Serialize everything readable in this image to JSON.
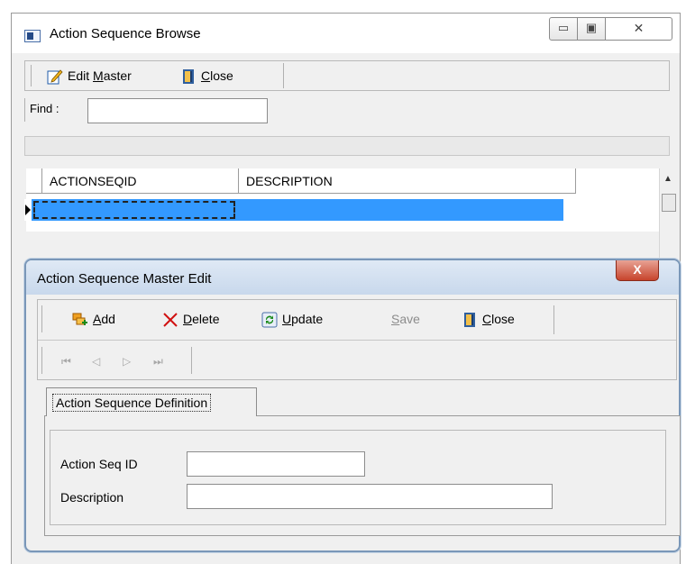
{
  "outer_window": {
    "title": "Action Sequence Browse",
    "caption_buttons": {
      "minimize": "▭",
      "maximize": "▣",
      "close": "✕"
    },
    "toolbar": {
      "edit_master": {
        "before": "Edit ",
        "underline": "M",
        "after": "aster"
      },
      "close": {
        "before": "",
        "underline": "C",
        "after": "lose"
      }
    },
    "find": {
      "label": "Find :",
      "value": ""
    },
    "grid": {
      "columns": [
        "ACTIONSEQID",
        "DESCRIPTION"
      ],
      "scroll_up": "▲"
    }
  },
  "dialog": {
    "title": "Action Sequence Master Edit",
    "close_glyph": "X",
    "toolbar": {
      "add": {
        "before": "",
        "underline": "A",
        "after": "dd"
      },
      "delete": {
        "before": "",
        "underline": "D",
        "after": "elete"
      },
      "update": {
        "before": "",
        "underline": "U",
        "after": "pdate"
      },
      "save": {
        "before": "",
        "underline": "S",
        "after": "ave"
      },
      "close": {
        "before": "",
        "underline": "C",
        "after": "lose"
      }
    },
    "nav": {
      "first": "⏮",
      "prev": "◁",
      "next": "▷",
      "last": "⏭"
    },
    "tab_label": "Action Sequence Definition",
    "fields": {
      "action_seq_id": {
        "label": "Action Seq ID",
        "value": ""
      },
      "description": {
        "label": "Description",
        "value": ""
      }
    }
  },
  "colors": {
    "selection": "#3399ff",
    "close_red": "#c7442c",
    "dialog_border": "#7a97b8"
  }
}
